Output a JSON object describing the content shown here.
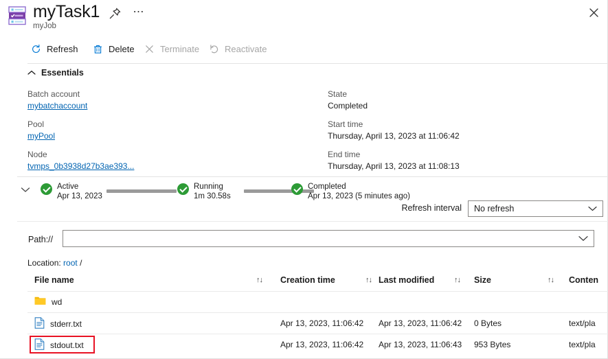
{
  "header": {
    "title": "myTask1",
    "subtitle": "myJob",
    "icon": "batch-task-icon",
    "pin_icon": "pin-icon",
    "more_icon": "ellipsis-icon",
    "close_icon": "close-icon"
  },
  "toolbar": {
    "items": [
      {
        "label": "Refresh",
        "icon": "refresh-icon",
        "enabled": true
      },
      {
        "label": "Delete",
        "icon": "trash-icon",
        "enabled": true
      },
      {
        "label": "Terminate",
        "icon": "x-icon",
        "enabled": false
      },
      {
        "label": "Reactivate",
        "icon": "reactivate-icon",
        "enabled": false
      }
    ]
  },
  "essentials": {
    "title": "Essentials",
    "collapse_icon": "chevron-up-icon",
    "left": [
      {
        "key": "Batch account",
        "value": "mybatchaccount",
        "link": true
      },
      {
        "key": "Pool",
        "value": "myPool",
        "link": true
      },
      {
        "key": "Node",
        "value": "tvmps_0b3938d27b3ae393...",
        "link": true
      }
    ],
    "right": [
      {
        "key": "State",
        "value": "Completed",
        "link": false
      },
      {
        "key": "Start time",
        "value": "Thursday, April 13, 2023 at 11:06:42",
        "link": false
      },
      {
        "key": "End time",
        "value": "Thursday, April 13, 2023 at 11:08:13",
        "link": false
      }
    ]
  },
  "timeline": {
    "expand_icon": "chevron-down-icon",
    "stages": [
      {
        "label": "Active",
        "detail": "Apr 13, 2023",
        "status_icon": "check-circle-icon"
      },
      {
        "label": "Running",
        "detail": "1m 30.58s",
        "status_icon": "check-circle-icon"
      },
      {
        "label": "Completed",
        "detail": "Apr 13, 2023 (5 minutes ago)",
        "status_icon": "check-circle-icon"
      }
    ],
    "success_color": "#2d9b36",
    "connector_color": "#9a9a9a"
  },
  "refresh_interval": {
    "label": "Refresh interval",
    "selected": "No refresh",
    "chevron_icon": "chevron-down-icon"
  },
  "path": {
    "label": "Path://",
    "value": "",
    "placeholder": "",
    "chevron_icon": "chevron-down-icon"
  },
  "location": {
    "prefix": "Location:",
    "link": "root",
    "suffix": "/"
  },
  "files_table": {
    "columns": [
      {
        "label": "File name",
        "sortable": false
      },
      {
        "label": "Creation time",
        "sortable": true,
        "sort_icon": "sort-icon"
      },
      {
        "label": "Last modified",
        "sortable": true,
        "sort_icon": "sort-icon"
      },
      {
        "label": "Size",
        "sortable": true,
        "sort_icon": "sort-icon"
      },
      {
        "label": "Conten",
        "sortable": true,
        "sort_icon": "sort-icon"
      }
    ],
    "rows": [
      {
        "name": "wd",
        "icon": "folder-icon",
        "type": "folder",
        "creation_time": "",
        "last_modified": "",
        "size": "",
        "content_type": "",
        "highlighted": false
      },
      {
        "name": "stderr.txt",
        "icon": "file-icon",
        "type": "file",
        "creation_time": "Apr 13, 2023, 11:06:42",
        "last_modified": "Apr 13, 2023, 11:06:42",
        "size": "0 Bytes",
        "content_type": "text/pla",
        "highlighted": false
      },
      {
        "name": "stdout.txt",
        "icon": "file-icon",
        "type": "file",
        "creation_time": "Apr 13, 2023, 11:06:42",
        "last_modified": "Apr 13, 2023, 11:06:43",
        "size": "953 Bytes",
        "content_type": "text/pla",
        "highlighted": true
      }
    ],
    "highlight_color": "#e81123"
  },
  "colors": {
    "link": "#0063b1",
    "accent": "#0063b1",
    "success": "#2d9b36",
    "highlight": "#e81123"
  }
}
